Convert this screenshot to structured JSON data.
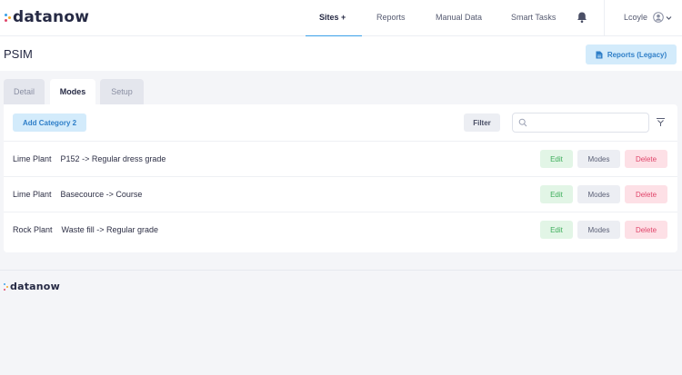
{
  "brand": {
    "name": "datanow",
    "dot_colors": [
      "#3aa0e8",
      "#f5a623",
      "#e0456a"
    ]
  },
  "nav": {
    "items": [
      {
        "label": "Sites +",
        "active": true
      },
      {
        "label": "Reports"
      },
      {
        "label": "Manual Data"
      },
      {
        "label": "Smart Tasks"
      }
    ],
    "bell_icon": "bell-icon",
    "user_name": "Lcoyle",
    "avatar_icon": "user-circle-icon",
    "chevron_icon": "chevron-down-icon"
  },
  "page": {
    "title": "PSIM",
    "reports_legacy_label": "Reports (Legacy)",
    "reports_icon": "document-icon"
  },
  "tabs": [
    {
      "label": "Detail"
    },
    {
      "label": "Modes",
      "active": true
    },
    {
      "label": "Setup"
    }
  ],
  "toolbar": {
    "add_category_label": "Add Category 2",
    "filter_label": "Filter",
    "search_placeholder": "",
    "search_value": "",
    "clear_filter_icon": "clear-filter-icon"
  },
  "rows": [
    {
      "plant": "Lime Plant",
      "description": "P152 -> Regular dress grade"
    },
    {
      "plant": "Lime Plant",
      "description": "Basecource -> Course"
    },
    {
      "plant": "Rock Plant",
      "description": "Waste fill -> Regular grade"
    }
  ],
  "row_actions": {
    "edit": "Edit",
    "modes": "Modes",
    "delete": "Delete"
  },
  "colors": {
    "accent": "#3aa0e8",
    "edit_text": "#3fae5c",
    "delete_text": "#e0456a"
  }
}
